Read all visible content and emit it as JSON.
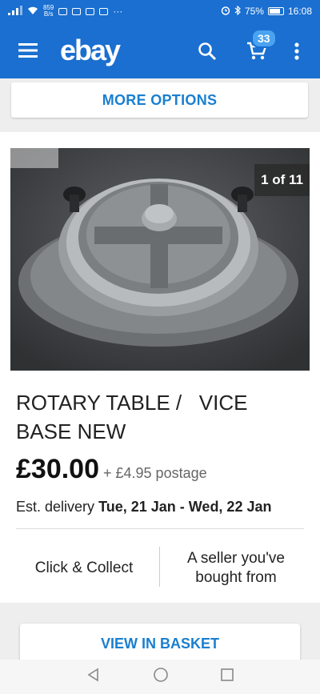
{
  "status_bar": {
    "net_speed_value": "859",
    "net_speed_unit": "B/s",
    "more": "···",
    "battery": "75%",
    "time": "16:08"
  },
  "app_bar": {
    "logo": "ebay",
    "cart_count": "33"
  },
  "more_options_label": "MORE OPTIONS",
  "listing": {
    "image_counter": "1 of 11",
    "title": "ROTARY TABLE /   VICE BASE NEW",
    "price": "£30.00",
    "postage": "+ £4.95 postage",
    "delivery_prefix": "Est. delivery",
    "delivery_dates": "Tue, 21 Jan - Wed, 22 Jan",
    "feature_left": "Click & Collect",
    "feature_right": "A seller you've bought from"
  },
  "view_basket_label": "VIEW IN BASKET",
  "colors": {
    "brand_blue": "#1a6fd0",
    "link_blue": "#1a7fd0",
    "badge_blue": "#4aa3f0"
  }
}
